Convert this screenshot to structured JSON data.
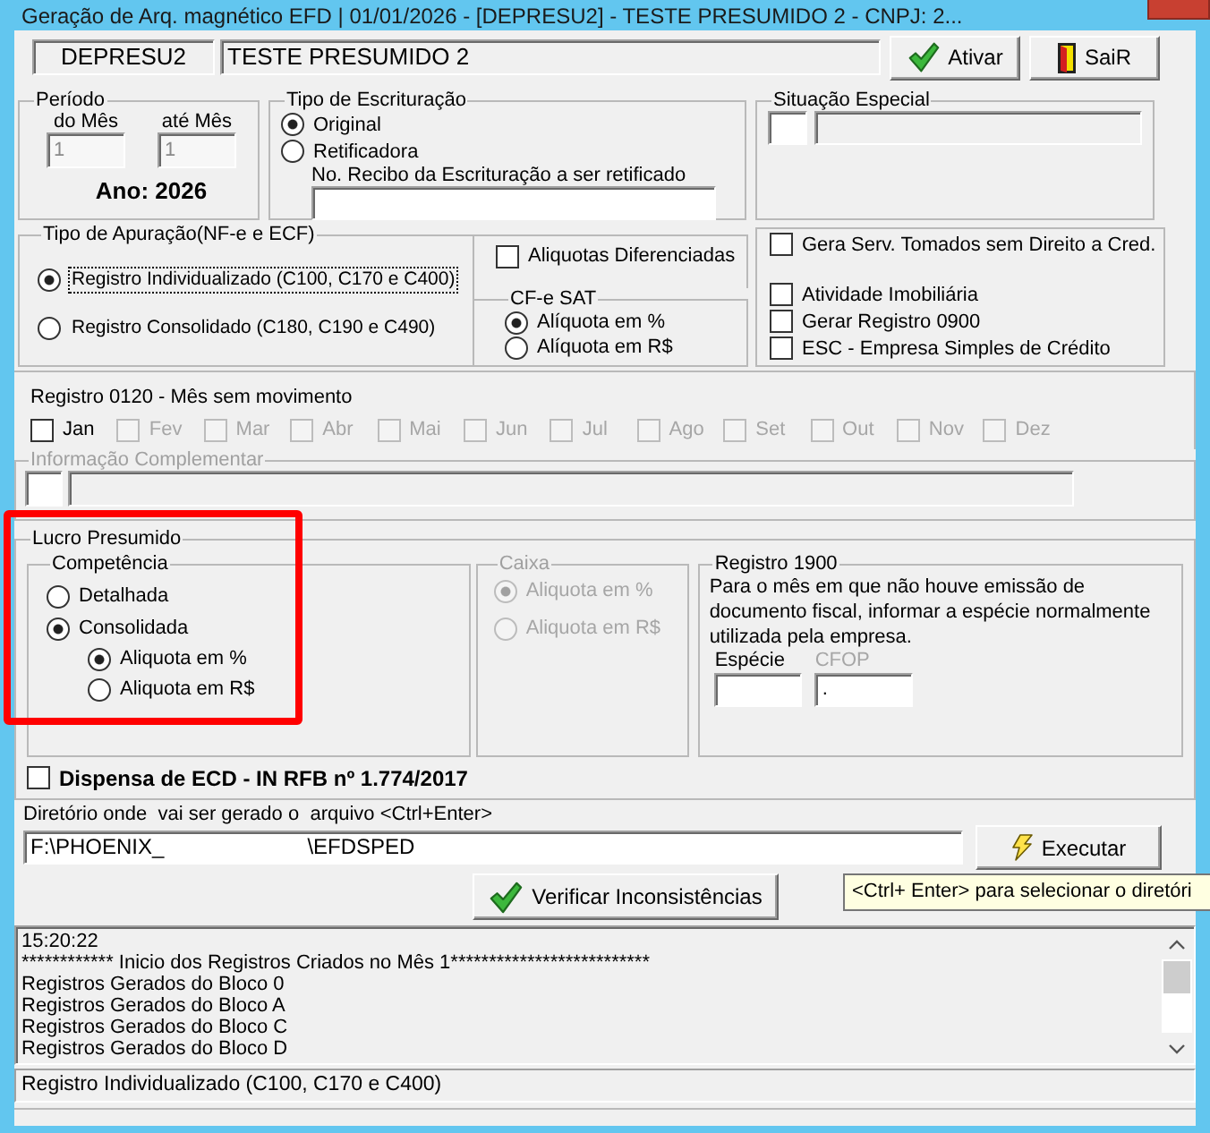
{
  "window": {
    "title": "Geração de Arq. magnético EFD | 01/01/2026 - [DEPRESU2] - TESTE PRESUMIDO 2 - CNPJ: 2..."
  },
  "header": {
    "code": "DEPRESU2",
    "company": "TESTE PRESUMIDO 2",
    "buttons": [
      {
        "label": "Ativar",
        "kind": "check"
      },
      {
        "label": "SaiR",
        "kind": "door"
      }
    ]
  },
  "periodo": {
    "title": "Período",
    "fields": [
      {
        "label": "do Mês",
        "value": "1",
        "disabled": true
      },
      {
        "label": "até Mês",
        "value": "1",
        "disabled": true
      }
    ],
    "year": "Ano: 2026"
  },
  "tipo_escrituracao": {
    "title": "Tipo de Escrituração",
    "options": [
      {
        "label": "Original",
        "selected": true
      },
      {
        "label": "Retificadora",
        "selected": false
      }
    ],
    "receipt_label": "No. Recibo da Escrituração a ser retificado"
  },
  "situacao_especial": {
    "title": "Situação Especial"
  },
  "tipo_apuracao": {
    "title": "Tipo de Apuração(NF-e e ECF)",
    "options": [
      {
        "label": "Registro Individualizado (C100, C170 e C400)",
        "selected": true,
        "focused": true
      },
      {
        "label": "Registro Consolidado (C180, C190 e C490)",
        "selected": false,
        "focused": false
      }
    ],
    "aliquotas_diferenciadas": {
      "label": "Aliquotas Diferenciadas",
      "checked": false
    },
    "cfe_sat": {
      "title": "CF-e SAT",
      "options": [
        {
          "label": "Alíquota em %",
          "selected": true
        },
        {
          "label": "Alíquota em R$",
          "selected": false
        }
      ]
    }
  },
  "settings": [
    {
      "label": "Gera Serv. Tomados sem Direito a Cred.",
      "checked": false
    },
    {
      "label": "Atividade Imobiliária",
      "checked": false
    },
    {
      "label": "Gerar Registro 0900",
      "checked": false
    },
    {
      "label": "ESC - Empresa Simples de Crédito",
      "checked": false
    }
  ],
  "registro_0120": {
    "title": "Registro 0120 - Mês sem movimento",
    "months": [
      {
        "label": "Jan",
        "checked": false,
        "disabled": false
      },
      {
        "label": "Fev",
        "checked": false,
        "disabled": true
      },
      {
        "label": "Mar",
        "checked": false,
        "disabled": true
      },
      {
        "label": "Abr",
        "checked": false,
        "disabled": true
      },
      {
        "label": "Mai",
        "checked": false,
        "disabled": true
      },
      {
        "label": "Jun",
        "checked": false,
        "disabled": true
      },
      {
        "label": "Jul",
        "checked": false,
        "disabled": true
      },
      {
        "label": "Ago",
        "checked": false,
        "disabled": true
      },
      {
        "label": "Set",
        "checked": false,
        "disabled": true
      },
      {
        "label": "Out",
        "checked": false,
        "disabled": true
      },
      {
        "label": "Nov",
        "checked": false,
        "disabled": true
      },
      {
        "label": "Dez",
        "checked": false,
        "disabled": true
      }
    ]
  },
  "informacao_complementar": {
    "title": "Informação Complementar",
    "disabled": true
  },
  "lucro_presumido": {
    "title": "Lucro Presumido",
    "highlighted": true,
    "competencia": {
      "title": "Competência",
      "options": [
        {
          "label": "Detalhada",
          "selected": false
        },
        {
          "label": "Consolidada",
          "selected": true
        }
      ],
      "sub_options": [
        {
          "label": "Aliquota em %",
          "selected": true
        },
        {
          "label": "Aliquota em R$",
          "selected": false
        }
      ]
    },
    "caixa": {
      "title": "Caixa",
      "disabled": true,
      "options": [
        {
          "label": "Aliquota em %",
          "selected": true
        },
        {
          "label": "Aliquota em R$",
          "selected": false
        }
      ]
    },
    "registro_1900": {
      "title": "Registro 1900",
      "text": "Para o mês em que não houve emissão de documento fiscal, informar a espécie normalmente utilizada pela empresa.",
      "fields": [
        {
          "label": "Espécie",
          "disabled": false
        },
        {
          "label": "CFOP",
          "value": ".",
          "disabled": true
        }
      ]
    },
    "dispensa_ecd": {
      "label": "Dispensa de ECD - IN RFB nº 1.774/2017",
      "checked": false
    }
  },
  "diretorio": {
    "label": "Diretório onde  vai ser gerado o  arquivo <Ctrl+Enter>",
    "value_parts": [
      "F:\\PHOENIX_",
      "\\EFDSPED"
    ]
  },
  "actions": [
    {
      "label": "Executar",
      "kind": "bolt"
    },
    {
      "label": "Verificar Inconsistências",
      "kind": "check"
    }
  ],
  "tooltip": {
    "text": "<Ctrl+ Enter> para selecionar o diretóri"
  },
  "log": {
    "lines": [
      "15:20:22",
      "************ Inicio dos Registros Criados no Mês 1**************************",
      "Registros Gerados do Bloco 0",
      "Registros Gerados do Bloco A",
      "Registros Gerados do Bloco C",
      "Registros Gerados do Bloco D"
    ]
  },
  "status_bar": {
    "text": "Registro Individualizado (C100, C170 e C400)"
  }
}
